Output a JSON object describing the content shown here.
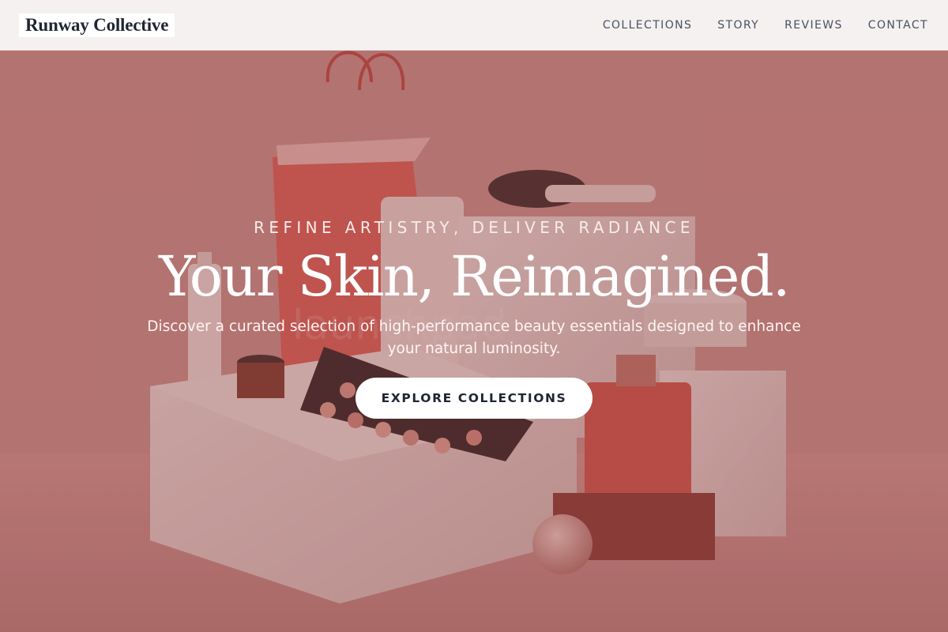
{
  "header": {
    "brand": "Runway Collective",
    "nav": [
      {
        "label": "COLLECTIONS"
      },
      {
        "label": "STORY"
      },
      {
        "label": "REVIEWS"
      },
      {
        "label": "CONTACT"
      }
    ]
  },
  "hero": {
    "eyebrow": "REFINE ARTISTRY, DELIVER RADIANCE",
    "headline": "Your Skin, Reimagined.",
    "subtext": "Discover a curated selection of high-performance beauty essentials designed to enhance your natural luminosity.",
    "cta_label": "EXPLORE COLLECTIONS",
    "background_image_text": "launchpad"
  },
  "colors": {
    "hero_tint": "#b47371",
    "header_bg": "#f4f1f0",
    "brand_text": "#1e2533",
    "cta_bg": "#ffffff"
  }
}
